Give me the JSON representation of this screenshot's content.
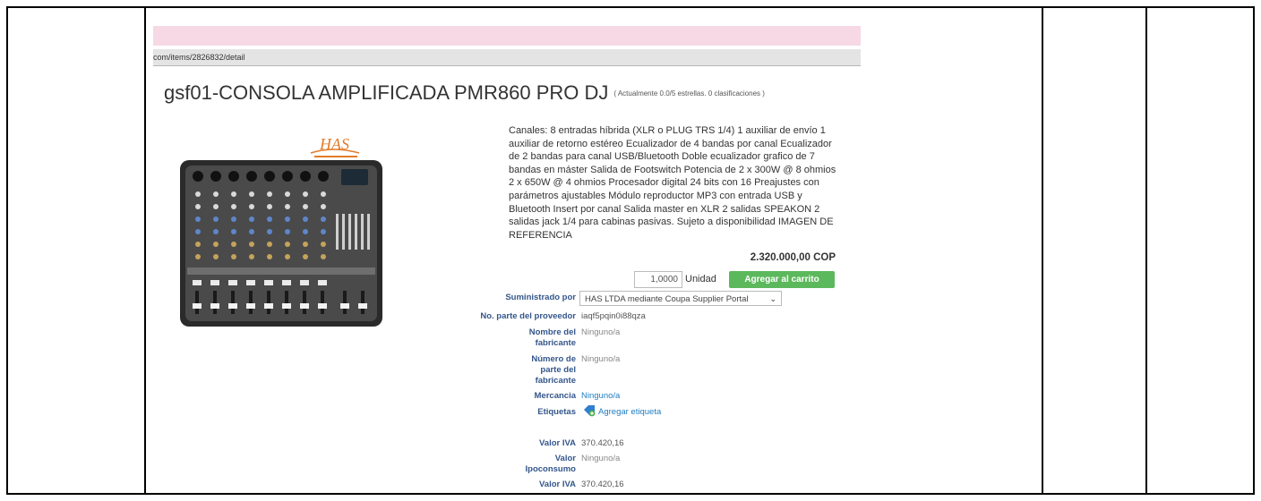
{
  "browser": {
    "url": "com/items/2826832/detail"
  },
  "product": {
    "title": "gsf01-CONSOLA AMPLIFICADA PMR860 PRO DJ",
    "rating_text": "( Actualmente 0.0/5 estrellas. 0 clasificaciones )",
    "image_logo_text": "HAS",
    "description": "Canales: 8 entradas híbrida (XLR o PLUG TRS 1/4) 1 auxiliar de envío 1 auxiliar de retorno estéreo Ecualizador de 4 bandas por canal Ecualizador de 2 bandas para canal USB/Bluetooth Doble ecualizador grafico de 7 bandas en máster Salida de Footswitch Potencia de 2 x 300W @ 8 ohmios 2 x 650W @ 4 ohmios Procesador digital 24 bits con 16 Preajustes con parámetros ajustables Módulo reproductor MP3 con entrada USB y Bluetooth Insert por canal Salida master en XLR 2 salidas SPEAKON 2 salidas jack 1/4 para cabinas pasivas. Sujeto a disponibilidad IMAGEN DE REFERENCIA",
    "price": "2.320.000,00 COP"
  },
  "cart": {
    "quantity": "1,0000",
    "unit_label": "Unidad",
    "add_button": "Agregar al carrito"
  },
  "fields": {
    "supplied_by_label": "Suministrado por",
    "supplied_by_value": "HAS LTDA mediante Coupa Supplier Portal",
    "supplier_part_label": "No. parte del proveedor",
    "supplier_part_value": "iaqf5pqin0i88qza",
    "manufacturer_label_1": "Nombre del",
    "manufacturer_label_2": "fabricante",
    "manufacturer_value": "Ninguno/a",
    "mfr_part_label_1": "Número de",
    "mfr_part_label_2": "parte del",
    "mfr_part_label_3": "fabricante",
    "mfr_part_value": "Ninguno/a",
    "commodity_label": "Mercancia",
    "commodity_value": "Ninguno/a",
    "tags_label": "Etiquetas",
    "tags_add": "Agregar etiqueta",
    "iva_label": "Valor IVA",
    "iva_value": "370.420,16",
    "ipoconsumo_label_1": "Valor",
    "ipoconsumo_label_2": "Ipoconsumo",
    "ipoconsumo_value": "Ninguno/a",
    "iva2_label": "Valor IVA",
    "iva2_value": "370.420,16"
  },
  "colors": {
    "accent_green": "#5cb85c",
    "label_blue": "#34568b",
    "link_blue": "#1f7cc1",
    "banner_pink": "#f6d9e5"
  }
}
